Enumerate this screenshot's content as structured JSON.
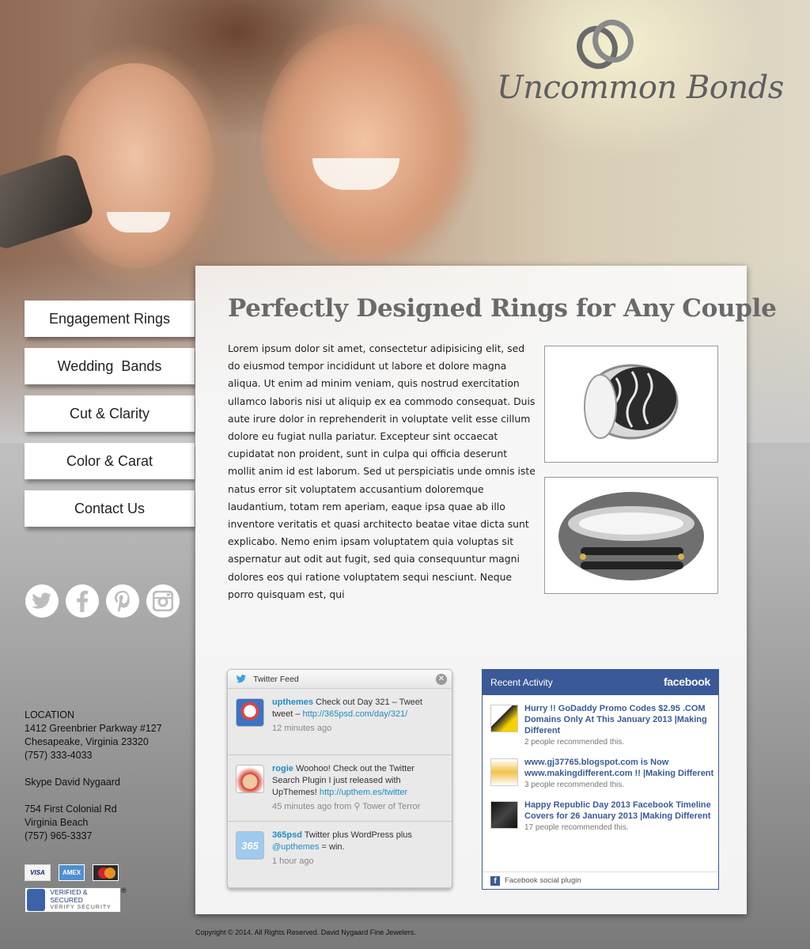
{
  "brand": {
    "name": "Uncommon Bonds",
    "logo_icon": "interlocked-rings-icon"
  },
  "nav": {
    "items": [
      {
        "label": "Engagement Rings"
      },
      {
        "label": "Wedding  Bands"
      },
      {
        "label": "Cut & Clarity"
      },
      {
        "label": "Color & Carat"
      },
      {
        "label": "Contact Us"
      }
    ]
  },
  "social": [
    "twitter-icon",
    "facebook-icon",
    "pinterest-icon",
    "instagram-icon"
  ],
  "location": {
    "heading": "LOCATION",
    "address1": "1412 Greenbrier Parkway #127",
    "address2": "Chesapeake, Virginia 23320",
    "phone1": "(757) 333-4033",
    "skype": "Skype David Nygaard",
    "address3": "754 First Colonial Rd",
    "address4": "Virginia Beach",
    "phone2": "(757) 965-3337"
  },
  "payment": {
    "cards": [
      "VISA",
      "AMEX",
      "MasterCard"
    ],
    "verified_line1": "VERIFIED & SECURED",
    "verified_line2": "VERIFY SECURITY",
    "registered": "®"
  },
  "content": {
    "heading": "Perfectly Designed Rings for Any Couple",
    "body": "Lorem ipsum dolor sit amet, consectetur adipisicing elit, sed do eiusmod tempor incididunt ut labore et dolore magna aliqua. Ut enim ad minim veniam, quis nostrud exercitation ullamco laboris nisi ut aliquip ex ea commodo consequat. Duis aute irure dolor in reprehenderit in voluptate velit esse cillum dolore eu fugiat nulla pariatur. Excepteur sint occaecat cupidatat non proident, sunt in culpa qui officia deserunt mollit anim id est laborum. Sed ut perspiciatis unde omnis iste natus error sit voluptatem accusantium doloremque laudantium, totam rem aperiam, eaque ipsa quae ab illo inventore veritatis et quasi architecto beatae vitae dicta sunt explicabo. Nemo enim ipsam voluptatem quia voluptas sit aspernatur aut odit aut fugit, sed quia consequuntur magni dolores eos qui ratione voluptatem sequi nesciunt. Neque porro quisquam est, qui"
  },
  "twitter": {
    "title": "Twitter Feed",
    "tweets": [
      {
        "user": "upthemes",
        "text": " Check out Day 321 – Tweet tweet – ",
        "link": "http://365psd.com/day/321/",
        "time": "12 minutes ago"
      },
      {
        "user": "rogie",
        "text": " Woohoo! Check out the Twitter Search Plugin I just released with UpThemes! ",
        "link": "http://upthem.es/twitter",
        "time": "45 minutes ago from ⚲ Tower of Terror"
      },
      {
        "user": "365psd",
        "text": " Twitter plus WordPress plus ",
        "link": "@upthemes",
        "text2": " = win.",
        "time": "1 hour ago"
      }
    ]
  },
  "facebook": {
    "title": "Recent Activity",
    "logo": "facebook",
    "items": [
      {
        "title": "Hurry !! GoDaddy Promo Codes $2.95 .COM Domains Only At This January 2013 |Making Different",
        "meta": "2 people recommended this."
      },
      {
        "title": "www.gj37765.blogspot.com is Now www.makingdifferent.com !! |Making Different",
        "meta": "3 people recommended this."
      },
      {
        "title": "Happy Republic Day 2013 Facebook Timeline Covers for 26 January 2013 |Making Different",
        "meta": "17 people recommended this."
      }
    ],
    "footer": "Facebook social plugin"
  },
  "footer": {
    "copyright": "Copyright © 2014. All Rights Reserved. David Nygaard Fine Jewelers."
  }
}
